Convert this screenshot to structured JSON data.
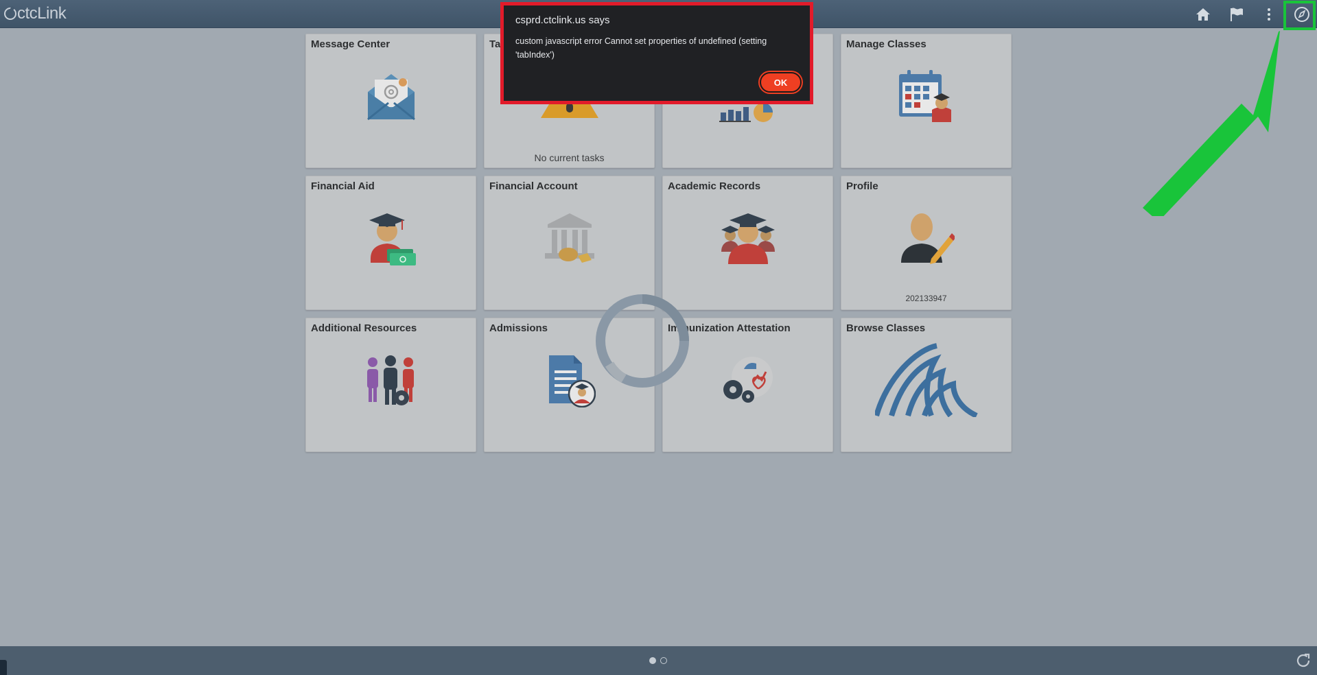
{
  "header": {
    "logo_text": "ctcLink",
    "icons": [
      "home-icon",
      "flag-icon",
      "more-vertical-icon",
      "navigator-compass-icon"
    ]
  },
  "tiles": [
    {
      "title": "Message Center",
      "icon": "envelope-icon",
      "subtitle": ""
    },
    {
      "title": "Ta",
      "icon": "tasks-warning-icon",
      "subtitle": "No current tasks"
    },
    {
      "title": "",
      "icon": "chart-icon",
      "subtitle": ""
    },
    {
      "title": "Manage Classes",
      "icon": "calendar-student-icon",
      "subtitle": ""
    },
    {
      "title": "Financial Aid",
      "icon": "graduate-money-icon",
      "subtitle": ""
    },
    {
      "title": "Financial Account",
      "icon": "bank-icon",
      "subtitle": ""
    },
    {
      "title": "Academic Records",
      "icon": "graduates-group-icon",
      "subtitle": ""
    },
    {
      "title": "Profile",
      "icon": "person-pencil-icon",
      "subtitle": "202133947"
    },
    {
      "title": "Additional Resources",
      "icon": "people-gear-icon",
      "subtitle": ""
    },
    {
      "title": "Admissions",
      "icon": "document-student-icon",
      "subtitle": ""
    },
    {
      "title": "Immunization Attestation",
      "icon": "gears-health-icon",
      "subtitle": ""
    },
    {
      "title": "Browse Classes",
      "icon": "ctclink-wave-logo-icon",
      "subtitle": ""
    }
  ],
  "dialog": {
    "title": "csprd.ctclink.us says",
    "message": "custom javascript error Cannot set properties of undefined (setting 'tabIndex')",
    "ok_label": "OK"
  },
  "footer": {
    "page_dots": 2,
    "active_dot": 1
  },
  "colors": {
    "topbar": "#42576b",
    "overlay_background": "#a1a9b1",
    "dialog_border": "#e21b2a",
    "ok_button": "#ee3f22",
    "highlight_arrow": "#19c43a"
  }
}
